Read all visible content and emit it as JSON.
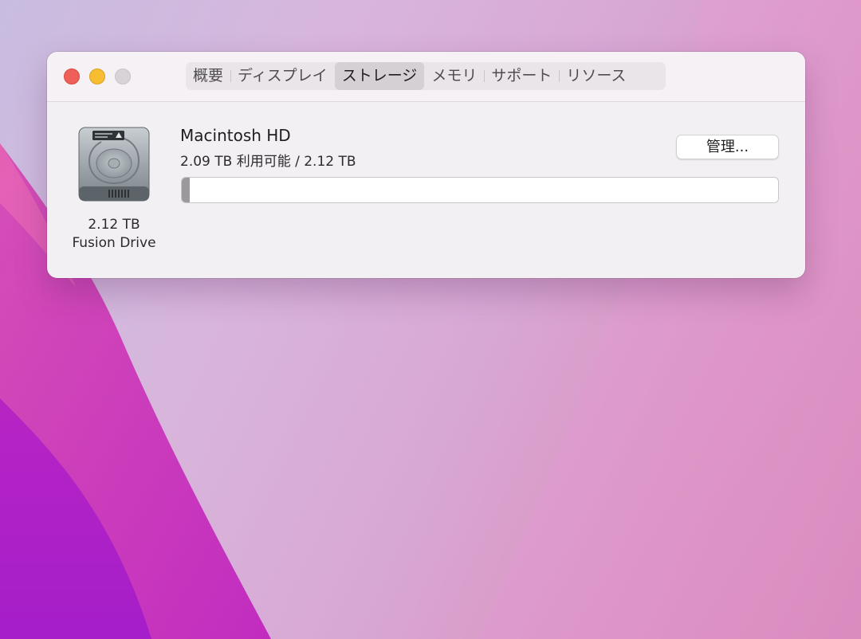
{
  "tabs": [
    {
      "label": "概要",
      "active": false
    },
    {
      "label": "ディスプレイ",
      "active": false
    },
    {
      "label": "ストレージ",
      "active": true
    },
    {
      "label": "メモリ",
      "active": false
    },
    {
      "label": "サポート",
      "active": false
    },
    {
      "label": "リソース",
      "active": false
    }
  ],
  "drive": {
    "icon": "hard-drive-icon",
    "size": "2.12 TB",
    "type": "Fusion Drive"
  },
  "volume": {
    "name": "Macintosh HD",
    "usage": "2.09 TB 利用可能 / 2.12 TB",
    "used_fraction": 0.014
  },
  "manage_button": {
    "label": "管理..."
  },
  "colors": {
    "close": "#ee5f57",
    "minimize": "#f5bd2f",
    "zoom": "#d7d3d6",
    "used_segment": "#9b999b"
  }
}
